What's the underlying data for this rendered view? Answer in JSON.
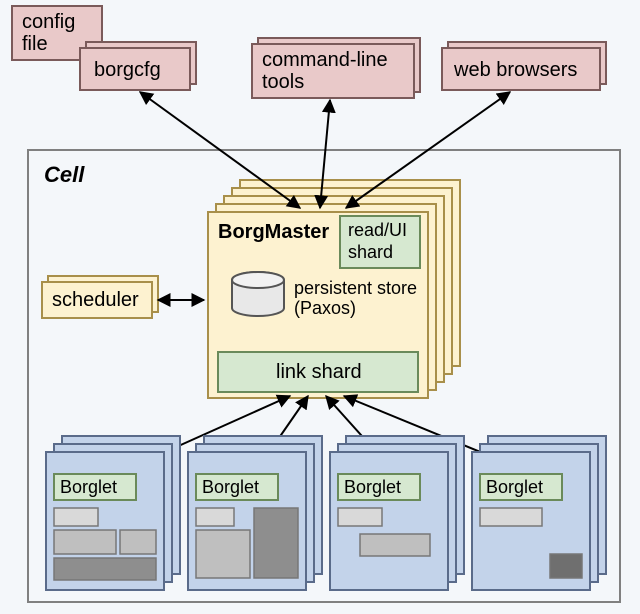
{
  "config_file": "config\nfile",
  "clients": {
    "borgcfg": "borgcfg",
    "cli": "command-line\ntools",
    "web": "web browsers"
  },
  "cell_label": "Cell",
  "scheduler": "scheduler",
  "borgmaster": {
    "title": "BorgMaster",
    "read_ui_shard": "read/UI\nshard",
    "persistent_store": "persistent store\n(Paxos)",
    "link_shard": "link shard"
  },
  "borglet": "Borglet",
  "colors": {
    "pink": "#e9c9c9",
    "pink_stroke": "#7a5a5a",
    "cream": "#fdf2d0",
    "cream_stroke": "#a88f4a",
    "blue": "#c3d3ea",
    "blue_stroke": "#5a6b8a",
    "green": "#d6e8d0",
    "green_stroke": "#6a8a5a",
    "gray1": "#d9d9d9",
    "gray2": "#bfbfbf",
    "gray3": "#8e8e8e",
    "gray4": "#6f6f6f",
    "cell_border": "#808080"
  }
}
